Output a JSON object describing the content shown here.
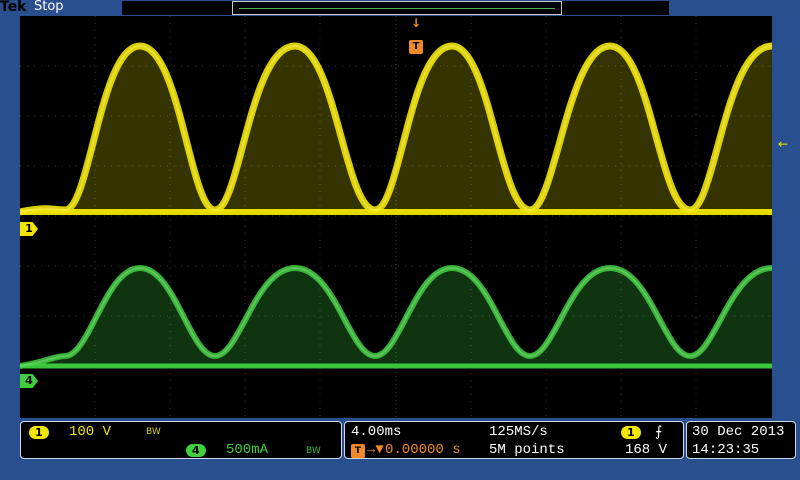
{
  "top": {
    "brand": "Tek",
    "state": "Stop"
  },
  "screen": {
    "ch1_marker": "1",
    "ch4_marker": "4",
    "trigger_position_marker": "T",
    "trigger_arrow": "↓",
    "trigger_level_marker": "←"
  },
  "status": {
    "ch1": {
      "badge": "1",
      "scale": "100 V",
      "bw": "BW"
    },
    "ch4": {
      "badge": "4",
      "scale": "500mA",
      "bw": "BW"
    },
    "timebase": {
      "time_per_div": "4.00ms",
      "sample_rate": "125MS/s",
      "record_length": "5M points",
      "trigger_position": "0.00000 s",
      "trigger_icon": "T",
      "trigger_position_arrow": "→▼",
      "trigger_source_badge": "1",
      "trigger_slope": "⨍",
      "trigger_level": "168 V"
    },
    "datetime": {
      "date": "30 Dec 2013",
      "time": "14:23:35"
    }
  },
  "colors": {
    "ch1": "#f2e600",
    "ch4": "#3fcf3f",
    "trigger": "#f08a24",
    "grid": "#6c6c6c",
    "panel_bg": "#2a4f8f"
  }
}
